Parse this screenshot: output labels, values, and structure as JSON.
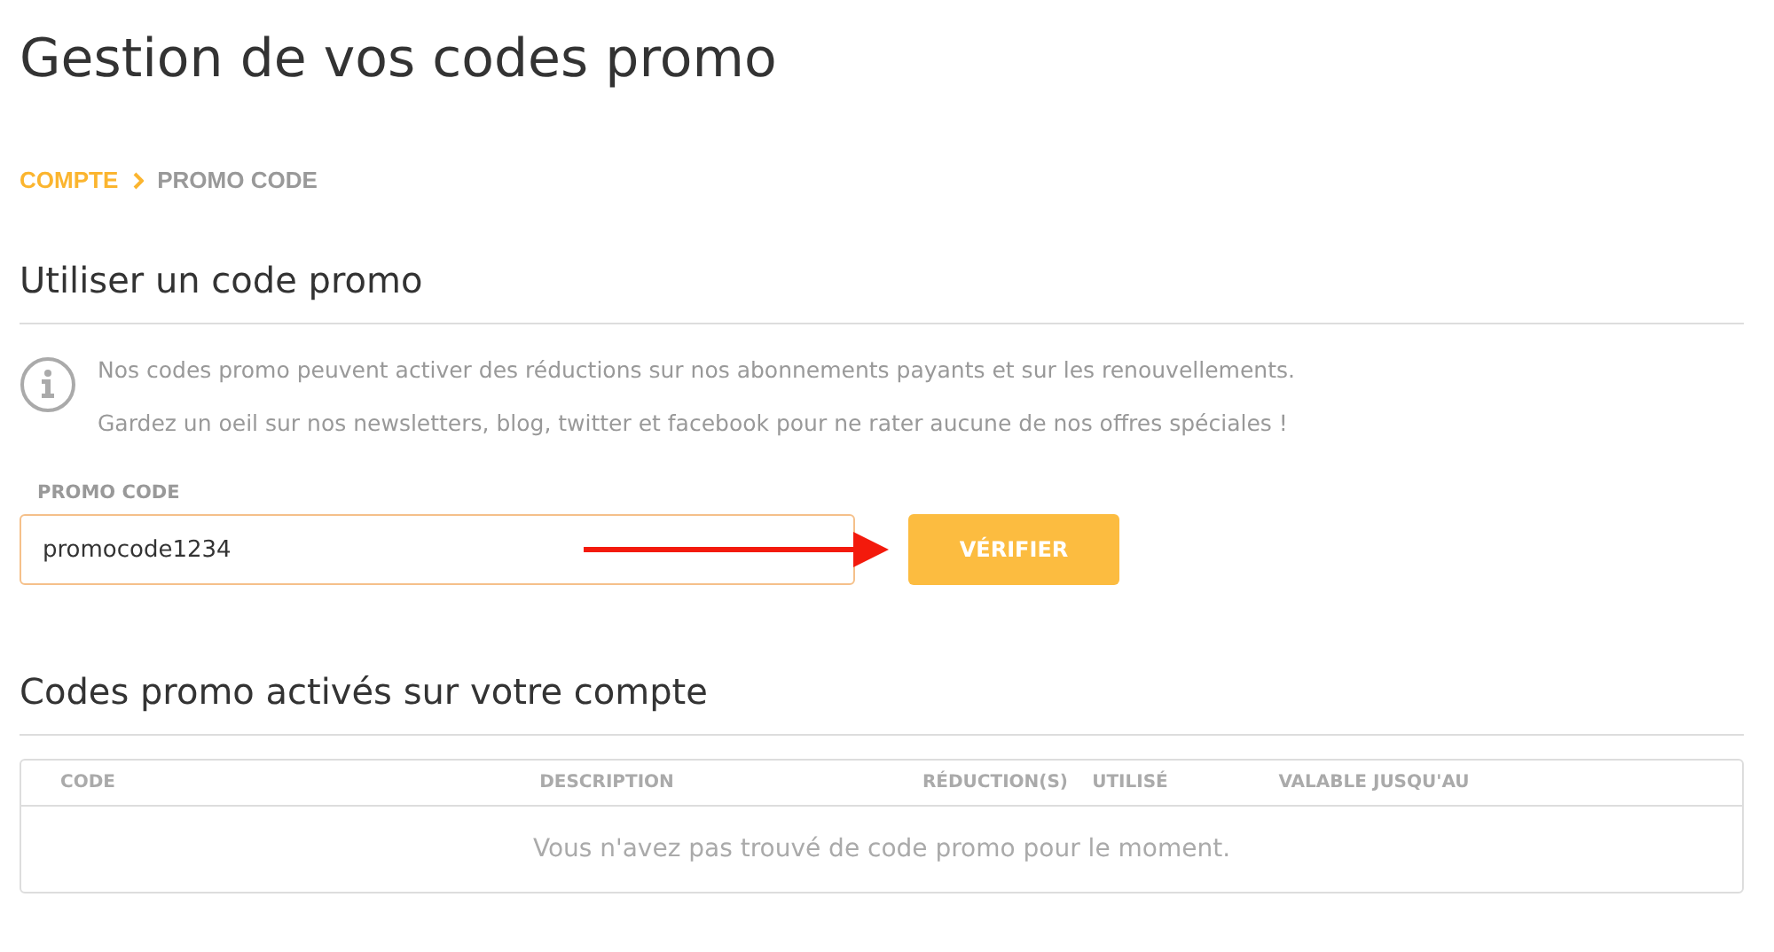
{
  "title": "Gestion de vos codes promo",
  "breadcrumb": [
    {
      "label": "COMPTE",
      "selected": false
    },
    {
      "label": "PROMO CODE",
      "selected": true
    }
  ],
  "use_section": {
    "heading": "Utiliser un code promo",
    "info": [
      "Nos codes promo peuvent activer des réductions sur nos abonnements payants et sur les renouvellements.",
      "Gardez un oeil sur nos newsletters, blog, twitter et facebook pour ne rater aucune de nos offres spéciales !"
    ],
    "field_label": "PROMO CODE",
    "field_value": "promocode1234",
    "button": "VÉRIFIER"
  },
  "active_section": {
    "heading": "Codes promo activés sur votre compte",
    "table": {
      "columns": [
        "CODE",
        "DESCRIPTION",
        "RÉDUCTION(S)",
        "UTILISÉ",
        "VALABLE JUSQU'AU"
      ],
      "empty_message": "Vous n'avez pas trouvé de code promo pour le moment."
    }
  }
}
